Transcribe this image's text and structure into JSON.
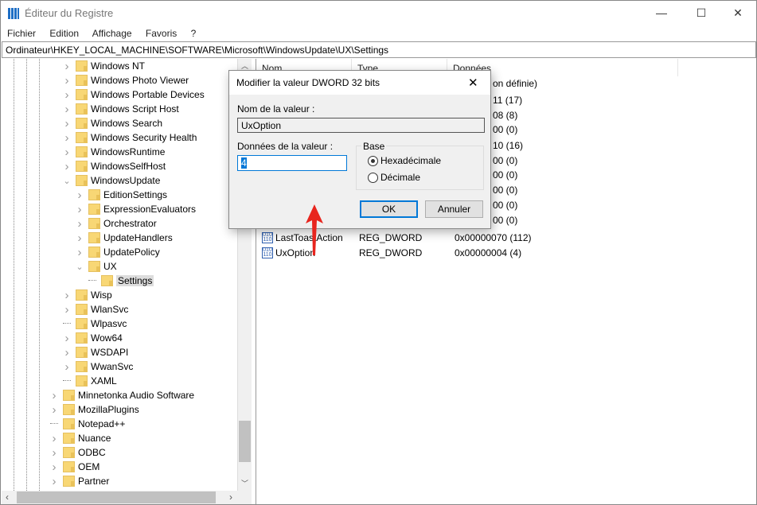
{
  "window": {
    "title": "Éditeur du Registre",
    "controls": [
      "—",
      "☐",
      "✕"
    ]
  },
  "menu": [
    "Fichier",
    "Edition",
    "Affichage",
    "Favoris",
    "?"
  ],
  "address": "Ordinateur\\HKEY_LOCAL_MACHINE\\SOFTWARE\\Microsoft\\WindowsUpdate\\UX\\Settings",
  "tree": [
    {
      "label": "Windows NT",
      "level": 1,
      "state": "collapsed"
    },
    {
      "label": "Windows Photo Viewer",
      "level": 1,
      "state": "collapsed"
    },
    {
      "label": "Windows Portable Devices",
      "level": 1,
      "state": "collapsed"
    },
    {
      "label": "Windows Script Host",
      "level": 1,
      "state": "collapsed"
    },
    {
      "label": "Windows Search",
      "level": 1,
      "state": "collapsed"
    },
    {
      "label": "Windows Security Health",
      "level": 1,
      "state": "collapsed"
    },
    {
      "label": "WindowsRuntime",
      "level": 1,
      "state": "collapsed"
    },
    {
      "label": "WindowsSelfHost",
      "level": 1,
      "state": "collapsed"
    },
    {
      "label": "WindowsUpdate",
      "level": 1,
      "state": "expanded"
    },
    {
      "label": "EditionSettings",
      "level": 2,
      "state": "collapsed"
    },
    {
      "label": "ExpressionEvaluators",
      "level": 2,
      "state": "collapsed"
    },
    {
      "label": "Orchestrator",
      "level": 2,
      "state": "collapsed"
    },
    {
      "label": "UpdateHandlers",
      "level": 2,
      "state": "collapsed"
    },
    {
      "label": "UpdatePolicy",
      "level": 2,
      "state": "collapsed"
    },
    {
      "label": "UX",
      "level": 2,
      "state": "expanded"
    },
    {
      "label": "Settings",
      "level": 3,
      "state": "leaf",
      "selected": true
    },
    {
      "label": "Wisp",
      "level": 1,
      "state": "collapsed"
    },
    {
      "label": "WlanSvc",
      "level": 1,
      "state": "collapsed"
    },
    {
      "label": "Wlpasvc",
      "level": 1,
      "state": "leaf"
    },
    {
      "label": "Wow64",
      "level": 1,
      "state": "collapsed"
    },
    {
      "label": "WSDAPI",
      "level": 1,
      "state": "collapsed"
    },
    {
      "label": "WwanSvc",
      "level": 1,
      "state": "collapsed"
    },
    {
      "label": "XAML",
      "level": 1,
      "state": "leaf"
    },
    {
      "label": "Minnetonka Audio Software",
      "level": 0,
      "state": "collapsed"
    },
    {
      "label": "MozillaPlugins",
      "level": 0,
      "state": "collapsed"
    },
    {
      "label": "Notepad++",
      "level": 0,
      "state": "leaf"
    },
    {
      "label": "Nuance",
      "level": 0,
      "state": "collapsed"
    },
    {
      "label": "ODBC",
      "level": 0,
      "state": "collapsed"
    },
    {
      "label": "OEM",
      "level": 0,
      "state": "collapsed"
    },
    {
      "label": "Partner",
      "level": 0,
      "state": "collapsed"
    }
  ],
  "list": {
    "columns": [
      "Nom",
      "Type",
      "Données"
    ],
    "hidden_data_fragments": [
      "on définie)",
      "11 (17)",
      "08 (8)",
      "00 (0)",
      "10 (16)",
      "00 (0)",
      "00 (0)",
      "00 (0)",
      "00 (0)",
      "00 (0)"
    ],
    "rows": [
      {
        "name": "LastToastAction",
        "type": "REG_DWORD",
        "data": "0x00000070 (112)"
      },
      {
        "name": "UxOption",
        "type": "REG_DWORD",
        "data": "0x00000004 (4)"
      }
    ]
  },
  "dialog": {
    "title": "Modifier la valeur DWORD 32 bits",
    "name_label": "Nom de la valeur :",
    "name_value": "UxOption",
    "data_label": "Données de la valeur :",
    "data_value": "4",
    "base_label": "Base",
    "base_options": [
      {
        "label": "Hexadécimale",
        "selected": true
      },
      {
        "label": "Décimale",
        "selected": false
      }
    ],
    "ok": "OK",
    "cancel": "Annuler",
    "close": "✕"
  },
  "annotation": {
    "color": "#e8251e",
    "type": "arrow-up"
  },
  "colors": {
    "accent": "#0078d7",
    "folder": "#f8d775"
  }
}
